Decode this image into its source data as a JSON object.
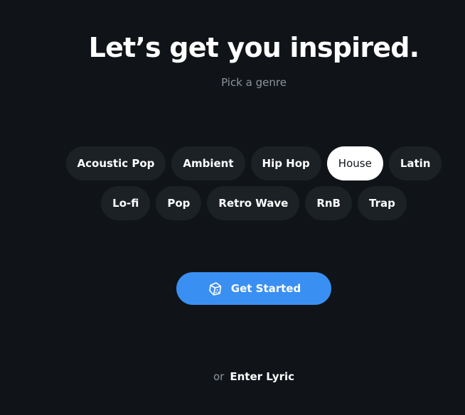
{
  "header": {
    "title": "Let’s get you inspired.",
    "subtitle": "Pick a genre"
  },
  "genres": {
    "row1": [
      "Acoustic Pop",
      "Ambient",
      "Hip Hop",
      "House",
      "Latin"
    ],
    "row2": [
      "Lo-fi",
      "Pop",
      "Retro Wave",
      "RnB",
      "Trap"
    ],
    "selected": "House"
  },
  "cta": {
    "label": "Get Started",
    "icon": "dice-icon"
  },
  "footer": {
    "or_label": "or",
    "link_label": "Enter Lyric"
  },
  "colors": {
    "background": "#101418",
    "chip": "#1c2126",
    "chip_selected": "#ffffff",
    "accent": "#3a8ff2",
    "muted_text": "#8d939a"
  }
}
